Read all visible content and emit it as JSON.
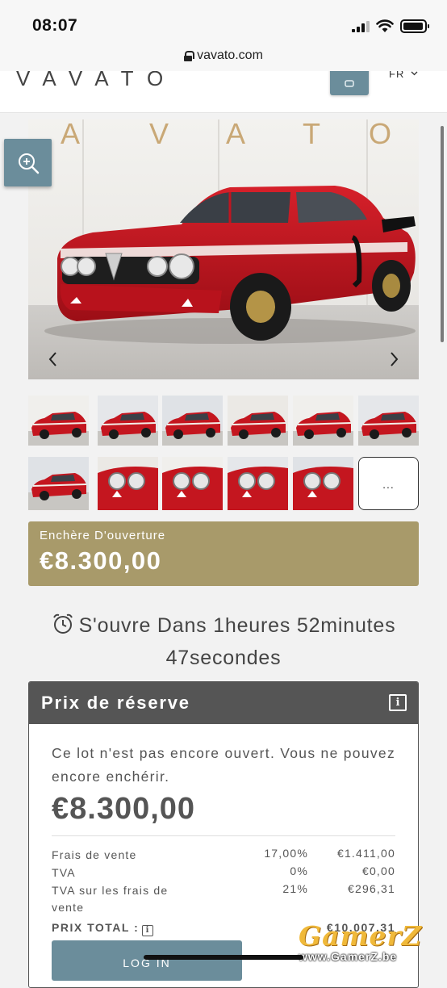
{
  "status_bar": {
    "time": "08:07"
  },
  "browser": {
    "url": "vavato.com"
  },
  "site_header": {
    "logo": "VAVATO",
    "language": "FR",
    "language_chevron": "chevron-down-icon"
  },
  "gallery": {
    "hero_icon_zoom": "magnifier-plus-icon",
    "prev_label": "‹",
    "next_label": "›",
    "more_label": "..."
  },
  "opening_bid": {
    "label": "Enchère D'ouverture",
    "value": "€8.300,00"
  },
  "countdown": {
    "line1": "S'ouvre Dans 1heures 52minutes",
    "line2": "47secondes"
  },
  "reserve": {
    "title": "Prix de réserve",
    "info_icon": "i",
    "message": "Ce lot n'est pas encore ouvert. Vous ne pouvez encore enchérir.",
    "amount": "€8.300,00",
    "fees": [
      {
        "label": "Frais de vente",
        "rate": "17,00%",
        "value": "€1.411,00"
      },
      {
        "label": "TVA",
        "rate": "0%",
        "value": "€0,00"
      },
      {
        "label": "TVA sur les frais de vente",
        "rate": "21%",
        "value": "€296,31"
      }
    ],
    "total_label": "PRIX TOTAL :",
    "total_value": "€10.007,31",
    "login_label": "LOG IN"
  },
  "watermark": {
    "brand": "GamerZ",
    "site": "www.GamerZ.be"
  },
  "colors": {
    "accent_blue": "#6b8d9b",
    "gold": "#a89a6a",
    "header_grey": "#555555"
  }
}
